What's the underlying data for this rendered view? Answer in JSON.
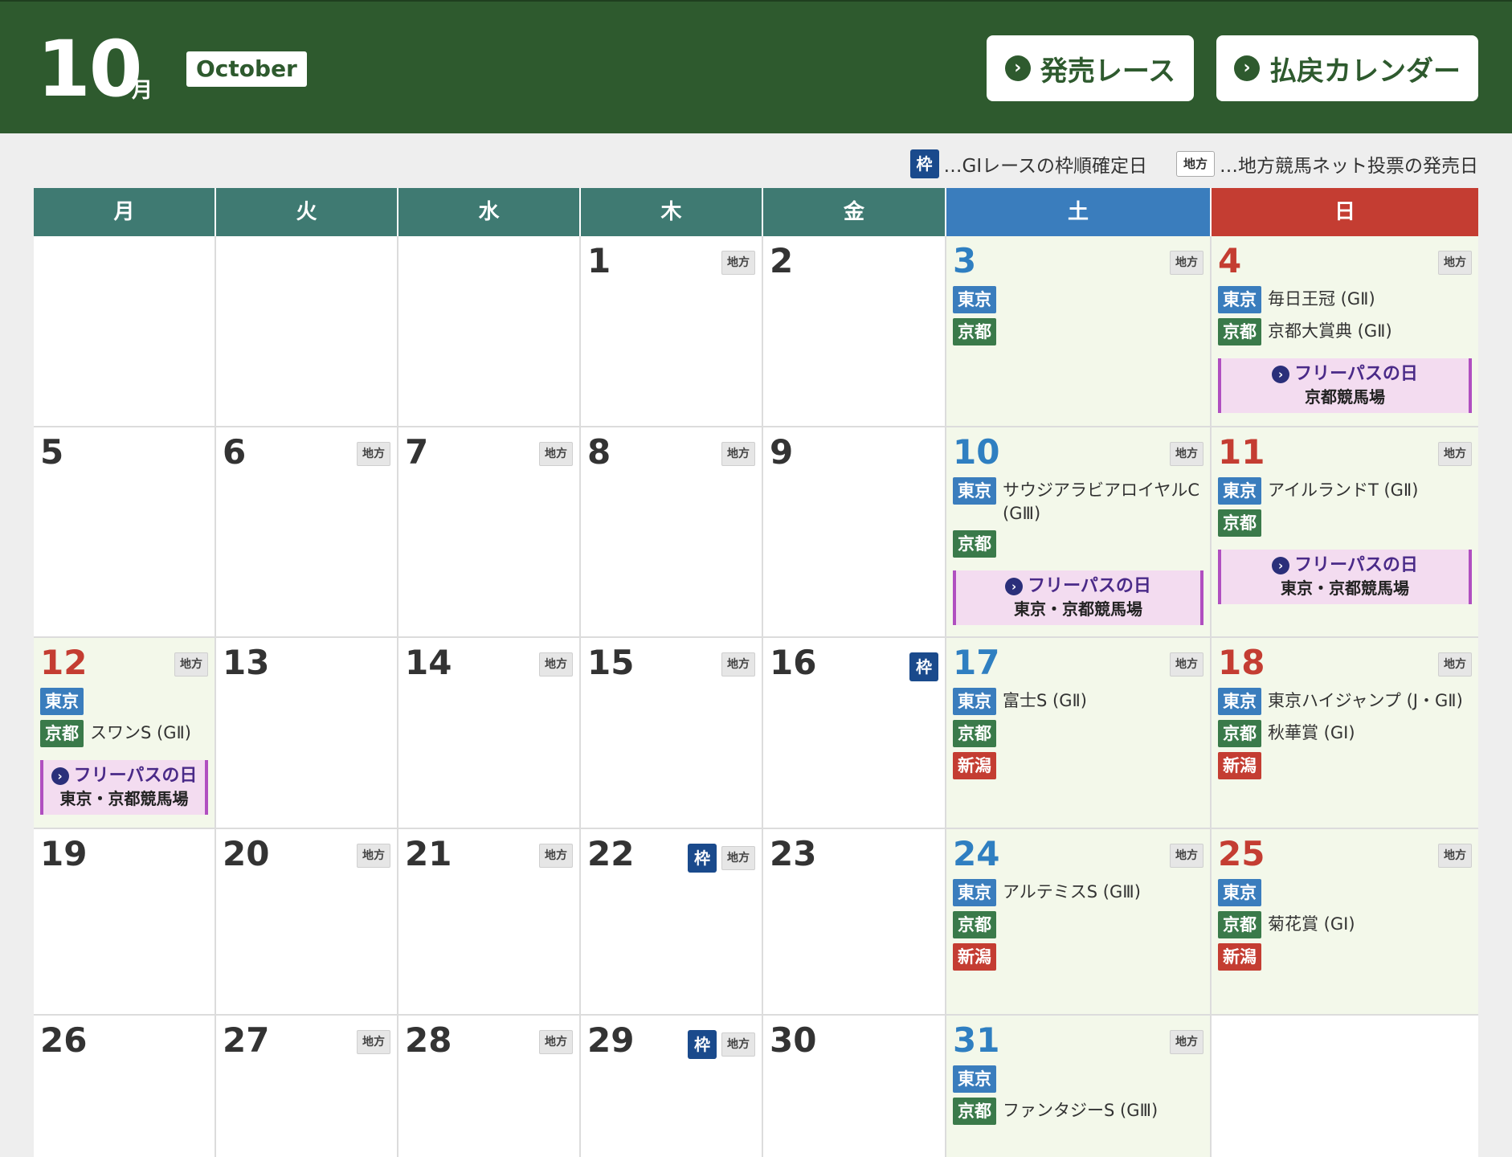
{
  "header": {
    "month_num": "10",
    "month_kanji": "月",
    "month_en": "October",
    "btn_sale": "発売レース",
    "btn_pay": "払戻カレンダー",
    "btn_icon": "›"
  },
  "legend": {
    "waku_badge": "枠",
    "waku_text": "…GⅠレースの枠順確定日",
    "chiho_badge": "地方",
    "chiho_text": "…地方競馬ネット投票の発売日"
  },
  "weekdays": [
    "月",
    "火",
    "水",
    "木",
    "金",
    "土",
    "日"
  ],
  "labels": {
    "chiho": "地方",
    "waku": "枠",
    "fp_icon": "›"
  },
  "colors": {
    "header_green": "#2e5a2e",
    "weekday_teal": "#3f7a72",
    "sat_blue": "#3a7dbd",
    "sun_red": "#c43d32",
    "freepass_pink": "#f3dcf0"
  },
  "days": {
    "d1": "1",
    "d2": "2",
    "d3": "3",
    "d4": "4",
    "d5": "5",
    "d6": "6",
    "d7": "7",
    "d8": "8",
    "d9": "9",
    "d10": "10",
    "d11": "11",
    "d12": "12",
    "d13": "13",
    "d14": "14",
    "d15": "15",
    "d16": "16",
    "d17": "17",
    "d18": "18",
    "d19": "19",
    "d20": "20",
    "d21": "21",
    "d22": "22",
    "d23": "23",
    "d24": "24",
    "d25": "25",
    "d26": "26",
    "d27": "27",
    "d28": "28",
    "d29": "29",
    "d30": "30",
    "d31": "31"
  },
  "venues": {
    "tokyo": "東京",
    "kyoto": "京都",
    "niigata": "新潟"
  },
  "races": {
    "d4_tokyo": "毎日王冠 (GⅡ)",
    "d4_kyoto": "京都大賞典 (GⅡ)",
    "d10_tokyo": "サウジアラビアロイヤルC (GⅢ)",
    "d11_tokyo": "アイルランドT (GⅡ)",
    "d12_kyoto": "スワンS (GⅡ)",
    "d17_tokyo": "富士S (GⅡ)",
    "d18_tokyo": "東京ハイジャンプ (J・GⅡ)",
    "d18_kyoto": "秋華賞 (GⅠ)",
    "d24_tokyo": "アルテミスS (GⅢ)",
    "d25_kyoto": "菊花賞 (GⅠ)",
    "d31_kyoto": "ファンタジーS (GⅢ)"
  },
  "freepass": {
    "title": "フリーパスの日",
    "d4_venue": "京都競馬場",
    "d10_venue": "東京・京都競馬場",
    "d11_venue": "東京・京都競馬場",
    "d12_venue": "東京・京都競馬場"
  }
}
